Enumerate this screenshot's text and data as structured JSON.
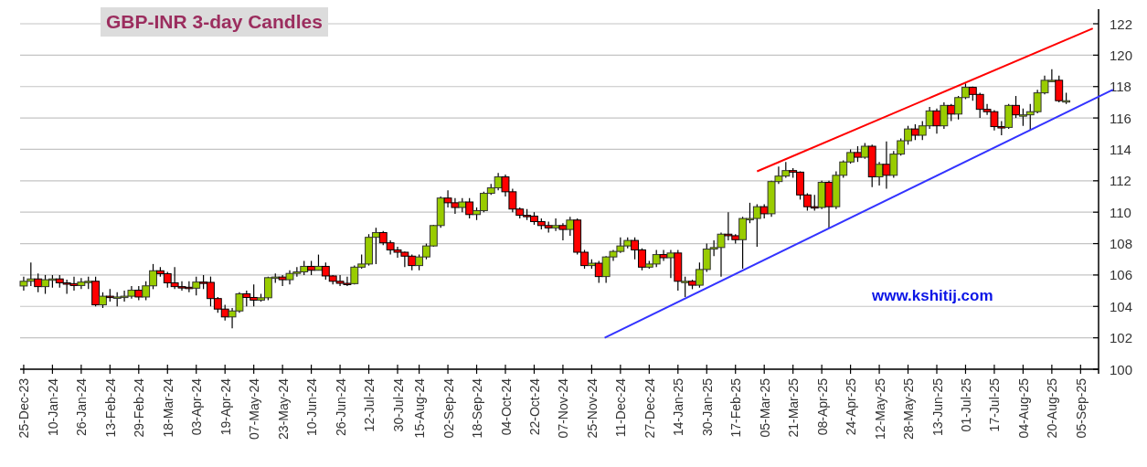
{
  "chart_data": {
    "type": "candlestick",
    "title": "GBP-INR 3-day Candles",
    "grid": true,
    "ylim": [
      100,
      122
    ],
    "yticks": [
      100,
      102,
      104,
      106,
      108,
      110,
      112,
      114,
      116,
      118,
      120,
      122
    ],
    "categories": [
      "25-Dec-23",
      null,
      null,
      null,
      "10-Jan-24",
      null,
      null,
      null,
      "26-Jan-24",
      null,
      null,
      null,
      "13-Feb-24",
      null,
      null,
      null,
      "29-Feb-24",
      null,
      null,
      null,
      "18-Mar-24",
      null,
      null,
      null,
      "03-Apr-24",
      null,
      null,
      null,
      "19-Apr-24",
      null,
      null,
      null,
      "07-May-24",
      null,
      null,
      null,
      "23-May-24",
      null,
      null,
      null,
      "10-Jun-24",
      null,
      null,
      null,
      "26-Jun-24",
      null,
      null,
      null,
      "12-Jul-24",
      null,
      null,
      null,
      "30-Jul-24",
      null,
      null,
      "15-Aug-24",
      null,
      null,
      null,
      "02-Sep-24",
      null,
      null,
      null,
      "18-Sep-24",
      null,
      null,
      null,
      "04-Oct-24",
      null,
      null,
      null,
      "22-Oct-24",
      null,
      null,
      null,
      "07-Nov-24",
      null,
      null,
      null,
      "25-Nov-24",
      null,
      null,
      null,
      "11-Dec-24",
      null,
      null,
      null,
      "27-Dec-24",
      null,
      null,
      null,
      "14-Jan-25",
      null,
      null,
      null,
      "30-Jan-25",
      null,
      null,
      null,
      "17-Feb-25",
      null,
      null,
      null,
      "05-Mar-25",
      null,
      null,
      null,
      "21-Mar-25",
      null,
      null,
      null,
      "08-Apr-25",
      null,
      null,
      null,
      "24-Apr-25",
      null,
      null,
      null,
      "12-May-25",
      null,
      null,
      null,
      "28-May-25",
      null,
      null,
      null,
      "13-Jun-25",
      null,
      null,
      null,
      "01-Jul-25",
      null,
      null,
      null,
      "17-Jul-25",
      null,
      null,
      null,
      "04-Aug-25",
      null,
      null,
      null,
      "20-Aug-25",
      null,
      null,
      null,
      "05-Sep-25",
      null,
      null
    ],
    "ohlc": [
      [
        105.3,
        105.9,
        105.0,
        105.6
      ],
      [
        105.6,
        106.8,
        105.3,
        105.75
      ],
      [
        105.75,
        106.1,
        104.9,
        105.26
      ],
      [
        105.26,
        106.0,
        104.8,
        105.7
      ],
      [
        105.7,
        106.0,
        105.2,
        105.75
      ],
      [
        105.75,
        106.0,
        105.2,
        105.5
      ],
      [
        105.5,
        105.7,
        104.8,
        105.45
      ],
      [
        105.45,
        105.9,
        105.0,
        105.33
      ],
      [
        105.33,
        105.8,
        105.1,
        105.55
      ],
      [
        105.55,
        105.9,
        105.1,
        105.6
      ],
      [
        105.6,
        105.9,
        104.0,
        104.1
      ],
      [
        104.1,
        104.9,
        103.9,
        104.65
      ],
      [
        104.65,
        105.1,
        104.3,
        104.57
      ],
      [
        104.57,
        104.9,
        104.0,
        104.6
      ],
      [
        104.6,
        105.0,
        104.3,
        104.65
      ],
      [
        104.65,
        105.3,
        104.5,
        105.03
      ],
      [
        105.03,
        105.3,
        104.4,
        104.6
      ],
      [
        104.6,
        105.6,
        104.4,
        105.31
      ],
      [
        105.31,
        106.7,
        105.1,
        106.27
      ],
      [
        106.27,
        106.5,
        105.9,
        106.08
      ],
      [
        106.08,
        106.2,
        105.2,
        105.5
      ],
      [
        105.5,
        106.5,
        105.1,
        105.26
      ],
      [
        105.26,
        105.6,
        105.0,
        105.22
      ],
      [
        105.22,
        105.6,
        104.9,
        105.16
      ],
      [
        105.16,
        105.9,
        104.7,
        105.55
      ],
      [
        105.55,
        106.0,
        105.1,
        105.53
      ],
      [
        105.53,
        105.9,
        104.0,
        104.5
      ],
      [
        104.5,
        104.6,
        103.6,
        103.83
      ],
      [
        103.83,
        104.1,
        103.1,
        103.33
      ],
      [
        103.33,
        103.9,
        102.6,
        103.71
      ],
      [
        103.71,
        104.9,
        103.6,
        104.8
      ],
      [
        104.8,
        105.0,
        104.0,
        104.57
      ],
      [
        104.57,
        105.4,
        104.0,
        104.4
      ],
      [
        104.4,
        104.8,
        104.3,
        104.55
      ],
      [
        104.55,
        105.9,
        104.4,
        105.83
      ],
      [
        105.83,
        106.1,
        105.5,
        105.87
      ],
      [
        105.87,
        106.0,
        105.3,
        105.7
      ],
      [
        105.7,
        106.3,
        105.4,
        106.1
      ],
      [
        106.1,
        106.5,
        105.9,
        106.2
      ],
      [
        106.2,
        106.9,
        106.0,
        106.55
      ],
      [
        106.55,
        106.9,
        106.0,
        106.3
      ],
      [
        106.3,
        107.3,
        106.3,
        106.55
      ],
      [
        106.55,
        106.8,
        105.7,
        105.94
      ],
      [
        105.94,
        106.0,
        105.4,
        105.6
      ],
      [
        105.6,
        106.0,
        105.3,
        105.47
      ],
      [
        105.47,
        105.9,
        105.3,
        105.45
      ],
      [
        105.45,
        106.6,
        105.4,
        106.5
      ],
      [
        106.5,
        107.3,
        106.4,
        106.7
      ],
      [
        106.7,
        108.6,
        106.6,
        108.4
      ],
      [
        108.4,
        109.0,
        106.7,
        108.7
      ],
      [
        108.7,
        108.8,
        107.9,
        108.05
      ],
      [
        108.05,
        108.2,
        107.3,
        107.6
      ],
      [
        107.6,
        107.8,
        107.1,
        107.45
      ],
      [
        107.45,
        107.5,
        106.5,
        107.2
      ],
      [
        107.2,
        107.3,
        106.3,
        106.6
      ],
      [
        106.6,
        107.3,
        106.3,
        107.15
      ],
      [
        107.15,
        108.0,
        107.0,
        107.85
      ],
      [
        107.85,
        109.2,
        107.8,
        109.15
      ],
      [
        109.15,
        111.0,
        109.0,
        110.9
      ],
      [
        110.9,
        111.4,
        110.3,
        110.6
      ],
      [
        110.6,
        110.9,
        109.9,
        110.3
      ],
      [
        110.3,
        110.9,
        110.0,
        110.65
      ],
      [
        110.65,
        110.9,
        109.6,
        109.85
      ],
      [
        109.85,
        110.3,
        109.5,
        110.1
      ],
      [
        110.1,
        111.3,
        110.0,
        111.2
      ],
      [
        111.2,
        111.8,
        111.1,
        111.55
      ],
      [
        111.55,
        112.5,
        111.4,
        112.25
      ],
      [
        112.25,
        112.4,
        111.0,
        111.3
      ],
      [
        111.3,
        111.5,
        110.0,
        110.2
      ],
      [
        110.2,
        110.3,
        109.6,
        109.8
      ],
      [
        109.8,
        110.2,
        109.5,
        109.75
      ],
      [
        109.75,
        110.0,
        109.2,
        109.4
      ],
      [
        109.4,
        109.6,
        108.9,
        109.15
      ],
      [
        109.15,
        109.4,
        108.7,
        109.0
      ],
      [
        109.0,
        109.6,
        108.8,
        109.15
      ],
      [
        109.15,
        109.3,
        108.2,
        108.9
      ],
      [
        108.9,
        109.7,
        108.5,
        109.5
      ],
      [
        109.5,
        109.6,
        107.3,
        107.45
      ],
      [
        107.45,
        107.6,
        106.4,
        106.6
      ],
      [
        106.6,
        107.0,
        106.4,
        106.75
      ],
      [
        106.75,
        106.9,
        105.5,
        105.9
      ],
      [
        105.9,
        107.2,
        105.5,
        107.15
      ],
      [
        107.15,
        107.6,
        106.9,
        107.5
      ],
      [
        107.5,
        108.4,
        107.4,
        107.85
      ],
      [
        107.85,
        108.4,
        107.7,
        108.2
      ],
      [
        108.2,
        108.4,
        107.0,
        107.6
      ],
      [
        107.6,
        107.7,
        106.3,
        106.5
      ],
      [
        106.5,
        106.9,
        106.4,
        106.7
      ],
      [
        106.7,
        107.6,
        106.5,
        107.3
      ],
      [
        107.3,
        107.6,
        106.9,
        107.1
      ],
      [
        107.1,
        107.6,
        105.8,
        107.4
      ],
      [
        107.4,
        107.6,
        105.0,
        105.6
      ],
      [
        105.6,
        105.9,
        104.6,
        105.6
      ],
      [
        105.6,
        105.7,
        105.1,
        105.35
      ],
      [
        105.35,
        106.8,
        105.2,
        106.35
      ],
      [
        106.35,
        108.0,
        106.2,
        107.65
      ],
      [
        107.65,
        108.2,
        107.2,
        107.75
      ],
      [
        107.75,
        108.7,
        105.9,
        108.6
      ],
      [
        108.6,
        110.0,
        108.2,
        108.5
      ],
      [
        108.5,
        108.6,
        108.0,
        108.25
      ],
      [
        108.25,
        109.7,
        106.4,
        109.6
      ],
      [
        109.6,
        110.6,
        109.3,
        109.6
      ],
      [
        109.6,
        110.5,
        107.8,
        110.35
      ],
      [
        110.35,
        110.5,
        109.6,
        109.9
      ],
      [
        109.9,
        112.0,
        109.7,
        111.95
      ],
      [
        111.95,
        112.9,
        111.8,
        112.3
      ],
      [
        112.3,
        113.2,
        112.2,
        112.65
      ],
      [
        112.65,
        112.8,
        112.2,
        112.55
      ],
      [
        112.55,
        112.6,
        110.8,
        111.1
      ],
      [
        111.1,
        111.2,
        110.1,
        110.35
      ],
      [
        110.35,
        111.1,
        110.1,
        110.3
      ],
      [
        110.3,
        112.0,
        110.2,
        111.9
      ],
      [
        111.9,
        112.0,
        109.0,
        110.35
      ],
      [
        110.35,
        112.6,
        110.2,
        112.35
      ],
      [
        112.35,
        113.3,
        112.2,
        113.2
      ],
      [
        113.2,
        114.0,
        113.1,
        113.8
      ],
      [
        113.8,
        114.2,
        113.2,
        113.5
      ],
      [
        113.5,
        114.4,
        113.4,
        114.2
      ],
      [
        114.2,
        114.3,
        111.6,
        112.25
      ],
      [
        112.25,
        113.2,
        111.7,
        113.05
      ],
      [
        113.05,
        114.5,
        111.5,
        112.35
      ],
      [
        112.35,
        113.9,
        112.2,
        113.7
      ],
      [
        113.7,
        114.7,
        113.6,
        114.55
      ],
      [
        114.55,
        115.5,
        114.3,
        115.3
      ],
      [
        115.3,
        115.6,
        114.6,
        114.9
      ],
      [
        114.9,
        115.8,
        114.6,
        115.5
      ],
      [
        115.5,
        116.7,
        115.3,
        116.45
      ],
      [
        116.45,
        116.6,
        115.0,
        115.5
      ],
      [
        115.5,
        117.0,
        115.3,
        116.8
      ],
      [
        116.8,
        116.9,
        115.8,
        116.25
      ],
      [
        116.25,
        117.4,
        115.9,
        117.3
      ],
      [
        117.3,
        118.2,
        117.2,
        117.95
      ],
      [
        117.95,
        118.0,
        117.1,
        117.5
      ],
      [
        117.5,
        117.6,
        116.0,
        116.55
      ],
      [
        116.55,
        116.9,
        116.2,
        116.4
      ],
      [
        116.4,
        116.5,
        115.2,
        115.45
      ],
      [
        115.45,
        115.8,
        114.9,
        115.4
      ],
      [
        115.4,
        116.9,
        115.3,
        116.8
      ],
      [
        116.8,
        117.4,
        116.0,
        116.2
      ],
      [
        116.2,
        116.6,
        115.5,
        116.2
      ],
      [
        116.2,
        116.9,
        115.2,
        116.4
      ],
      [
        116.4,
        117.8,
        116.3,
        117.6
      ],
      [
        117.6,
        118.7,
        117.5,
        118.4
      ],
      [
        118.4,
        119.1,
        118.3,
        118.4
      ],
      [
        118.4,
        118.7,
        117.0,
        117.1
      ],
      [
        117.1,
        117.6,
        116.9,
        117.1
      ],
      null,
      null,
      null,
      null
    ]
  },
  "source_label": "www.kshitij.com"
}
